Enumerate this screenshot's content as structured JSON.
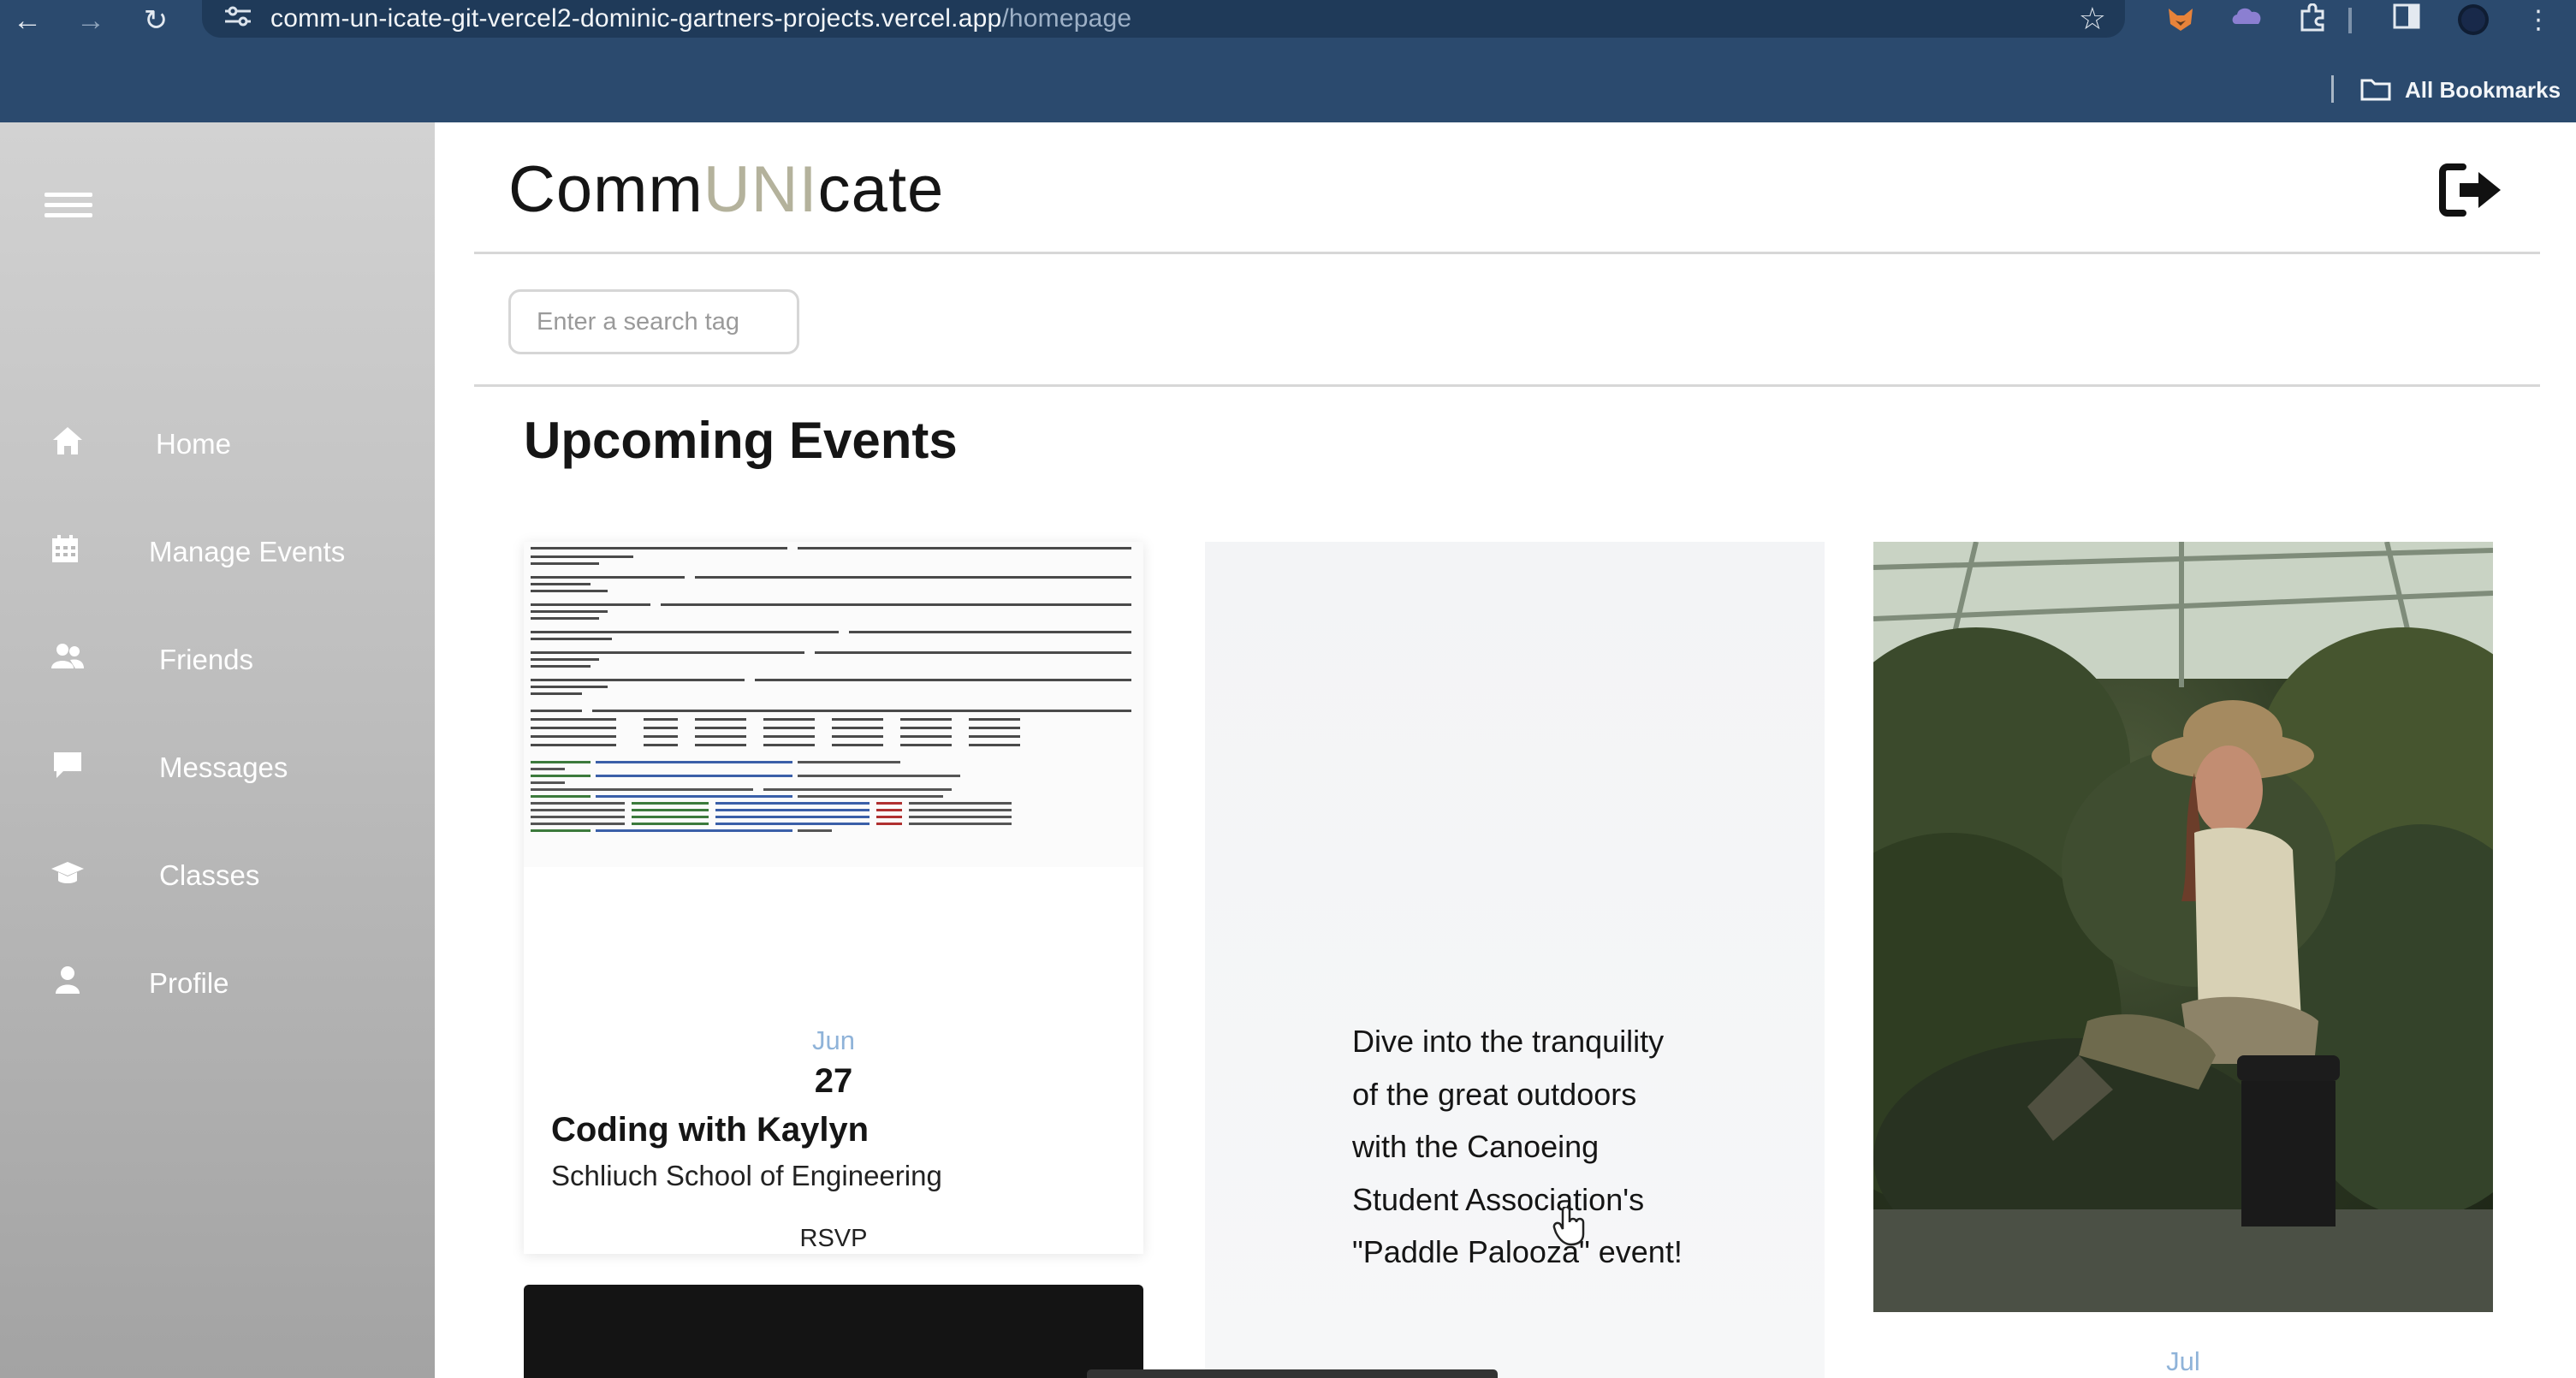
{
  "browser": {
    "nav": {
      "back_icon": "←",
      "forward_icon": "→",
      "reload_icon": "↻"
    },
    "url_host": "comm-un-icate-git-vercel2-dominic-gartners-projects.vercel.app",
    "url_path": "/homepage",
    "bookmarks_label": "All Bookmarks"
  },
  "sidebar": {
    "items": [
      {
        "label": "Home",
        "icon": "home-icon"
      },
      {
        "label": "Manage Events",
        "icon": "calendar-icon"
      },
      {
        "label": "Friends",
        "icon": "friends-icon"
      },
      {
        "label": "Messages",
        "icon": "message-icon"
      },
      {
        "label": "Classes",
        "icon": "graduation-cap-icon"
      },
      {
        "label": "Profile",
        "icon": "user-icon"
      }
    ]
  },
  "header": {
    "brand_prefix": "Comm",
    "brand_accent": "UNI",
    "brand_suffix": "cate",
    "accent_color": "#b4b29c"
  },
  "search": {
    "placeholder": "Enter a search tag"
  },
  "section": {
    "title": "Upcoming Events"
  },
  "events": [
    {
      "month": "Jun",
      "day": "27",
      "title": "Coding with Kaylyn",
      "location": "Schliuch School of Engineering",
      "action_label": "RSVP"
    },
    {
      "description": "Dive into the tranquility of the great outdoors with the Canoeing Student Association's \"Paddle Palooza\" event!"
    },
    {
      "month": "Jul"
    }
  ]
}
